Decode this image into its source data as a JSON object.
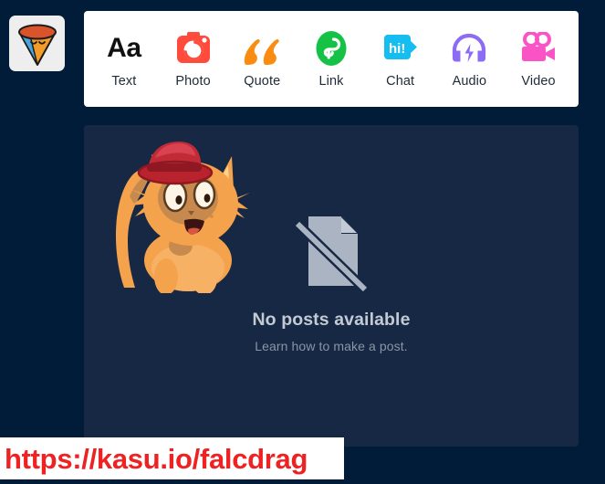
{
  "page": {
    "background_color": "#011c38",
    "panel_color": "#162844",
    "card_color": "#ffffff"
  },
  "avatar": {
    "name": "cone-blog-avatar",
    "icon": "ice-cream-cone-avatar",
    "background_color": "#eeeeee",
    "cone_color": "#f59b2a",
    "top_color": "#d9542b",
    "side_color": "#4aa3dd"
  },
  "post_types": {
    "items": [
      {
        "label": "Text",
        "icon": "text-aa-icon",
        "glyph": "Aa",
        "color": "#111111"
      },
      {
        "label": "Photo",
        "icon": "camera-icon",
        "glyph": "",
        "color": "#ff4b3c"
      },
      {
        "label": "Quote",
        "icon": "quote-marks-icon",
        "glyph": "",
        "color": "#f98c11"
      },
      {
        "label": "Link",
        "icon": "link-chain-icon",
        "glyph": "",
        "color": "#16c246"
      },
      {
        "label": "Chat",
        "icon": "chat-bubble-icon",
        "glyph": "hi!",
        "color": "#16bdf0"
      },
      {
        "label": "Audio",
        "icon": "headphones-icon",
        "glyph": "",
        "color": "#8d6cf5"
      },
      {
        "label": "Video",
        "icon": "movie-camera-icon",
        "glyph": "",
        "color": "#f953c6"
      }
    ]
  },
  "posts_panel": {
    "mascot": {
      "icon": "cat-with-fedora-mascot",
      "fur_color": "#f5a24d",
      "hat_color": "#b8232e"
    },
    "empty_state": {
      "icon": "no-document-icon",
      "icon_color": "#aab4c2",
      "title": "No posts available",
      "subtitle": "Learn how to make a post."
    }
  },
  "url_banner": {
    "url": "https://kasu.io/falcdrag",
    "text_color": "#ee2222",
    "background_color": "#ffffff"
  }
}
